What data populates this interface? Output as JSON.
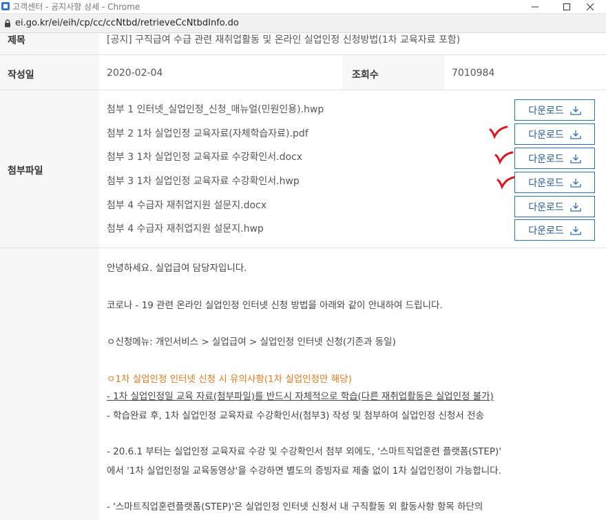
{
  "window": {
    "title": "고객센터 - 공지사항 상세 - Chrome",
    "url": "ei.go.kr/ei/eih/cp/cc/ccNtbd/retrieveCcNtbdInfo.do"
  },
  "notice": {
    "title_label": "제목",
    "title_value": "[공지] 구직급여 수급 관련 재취업활동 및 온라인 실업인정 신청방법(1차 교육자료 포함)",
    "date_label": "작성일",
    "date_value": "2020-02-04",
    "views_label": "조회수",
    "views_value": "7010984",
    "files_label": "첨부파일"
  },
  "attachments": [
    {
      "name": "첨부 1 인터넷_실업인정_신청_매뉴얼(민원인용).hwp",
      "button": "다운로드",
      "checked": false
    },
    {
      "name": "첨부 2 1차 실업인정 교육자료(자체학습자료).pdf",
      "button": "다운로드",
      "checked": true
    },
    {
      "name": "첨부 3 1차 실업인정 교육자료 수강확인서.docx",
      "button": "다운로드",
      "checked": true
    },
    {
      "name": "첨부 3 1차 실업인정 교육자료 수강확인서.hwp",
      "button": "다운로드",
      "checked": true
    },
    {
      "name": "첨부 4 수급자 재취업지원 설문지.docx",
      "button": "다운로드",
      "checked": false
    },
    {
      "name": "첨부 4 수급자 재취업지원 설문지.hwp",
      "button": "다운로드",
      "checked": false
    }
  ],
  "body": {
    "greeting": "안녕하세요. 실업급여 담당자입니다.",
    "intro": "코로나 - 19 관련 온라인 실업인정 인터넷 신청 방법을 아래와 같이 안내하여 드립니다.",
    "menu": "ㅇ신청메뉴: 개인서비스 > 실업급여 > 실업인정 인터넷 신청(기존과 동일)",
    "notice_head": "ㅇ1차 실업인정 인터넷 신청 시 유의사항(1차 실업인정만 해당)",
    "line1": " - 1차 실업인정일 교육 자료(첨부파일)를 반드시 자체적으로 학습(다른 재취업활동은 실업인정 불가)",
    "line2": " - 학습완료 후, 1차 실업인정 교육자료 수강확인서(첨부3) 작성 및 첨부하여 실업인정 신청서 전송",
    "line3": " - 20.6.1 부터는 실업인정 교육자료 수강 및 수강확인서 첨부 외에도, '스마트직업훈련 플랫폼(STEP)'",
    "line4": "에서 '1차 실업인정일 교육동영상'을 수강하면 별도의 증빙자료 제출 없이 1차 실업인정이 가능합니다.",
    "line5": " - '스마트직업훈련플랫폼(STEP)'은 실업인정 인터넷 신청서 내 구직활동 외 활동사항 항목 하단의"
  },
  "colors": {
    "accent": "#2d6fb3",
    "check_mark": "#e0141e",
    "highlight": "#e07b1f",
    "header_bg": "#f7f7f7"
  },
  "icons": [
    "favicon-icon",
    "minimize-icon",
    "maximize-icon",
    "close-icon",
    "lock-icon",
    "download-icon",
    "check-mark-icon"
  ]
}
